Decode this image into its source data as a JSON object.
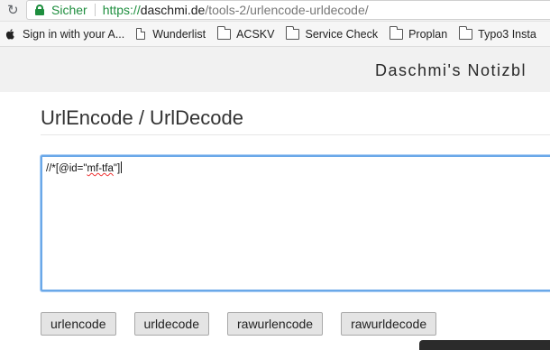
{
  "browser": {
    "reload_icon": "reload-icon",
    "secure_label": "Sicher",
    "url": {
      "scheme": "https://",
      "domain": "daschmi.de",
      "path": "/tools-2/urlencode-urldecode/"
    },
    "bookmarks": [
      {
        "icon": "apple-icon",
        "label": "Sign in with your A..."
      },
      {
        "icon": "document-icon",
        "label": "Wunderlist"
      },
      {
        "icon": "folder-icon",
        "label": "ACSKV"
      },
      {
        "icon": "folder-icon",
        "label": "Service Check"
      },
      {
        "icon": "folder-icon",
        "label": "Proplan"
      },
      {
        "icon": "folder-icon",
        "label": "Typo3 Insta"
      }
    ]
  },
  "site": {
    "title": "Daschmi's Notizbl"
  },
  "tool": {
    "heading": "UrlEncode / UrlDecode",
    "input_prefix": "//*[@id=\"",
    "input_misspelled": "mf-tfa",
    "input_suffix": "\"]",
    "buttons": {
      "urlencode": "urlencode",
      "urldecode": "urldecode",
      "rawurlencode": "rawurlencode",
      "rawurldecode": "rawurldecode"
    }
  },
  "colors": {
    "secure_green": "#1e8e3e",
    "focus_blue": "#6aa8e8"
  }
}
